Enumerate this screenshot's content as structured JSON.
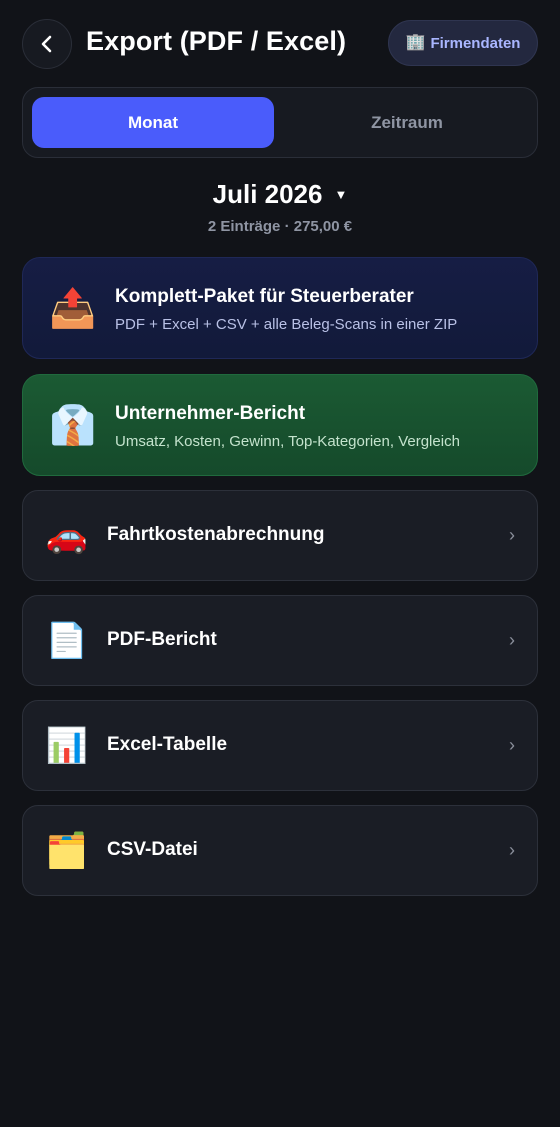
{
  "header": {
    "title": "Export (PDF / Excel)",
    "company_button_icon": "🏢",
    "company_button_label": "Firmendaten"
  },
  "segmented": {
    "month_label": "Monat",
    "range_label": "Zeitraum",
    "selected": "Monat"
  },
  "period": {
    "month": "Juli 2026",
    "caret": "▼",
    "summary": "2 Einträge · 275,00 €"
  },
  "cards": {
    "complete": {
      "icon": "📤",
      "title": "Komplett-Paket für Steuerberater",
      "subtitle": "PDF + Excel + CSV + alle Beleg-Scans in einer ZIP"
    },
    "report": {
      "icon": "👔",
      "title": "Unternehmer-Bericht",
      "subtitle": "Umsatz, Kosten, Gewinn, Top-Kategorien, Vergleich"
    }
  },
  "list": {
    "chevron": "›",
    "items": [
      {
        "icon": "🚗",
        "label": "Fahrtkostenabrechnung"
      },
      {
        "icon": "📄",
        "label": "PDF-Bericht"
      },
      {
        "icon": "📊",
        "label": "Excel-Tabelle"
      },
      {
        "icon": "🗂️",
        "label": "CSV-Datei"
      }
    ]
  },
  "colors": {
    "background": "#111318",
    "accent": "#4a5cfb",
    "card_blue": "#151c42",
    "card_green": "#18522f",
    "row": "#1a1d25",
    "muted_text": "#8f95a3",
    "company_text": "#a9b6ff"
  }
}
